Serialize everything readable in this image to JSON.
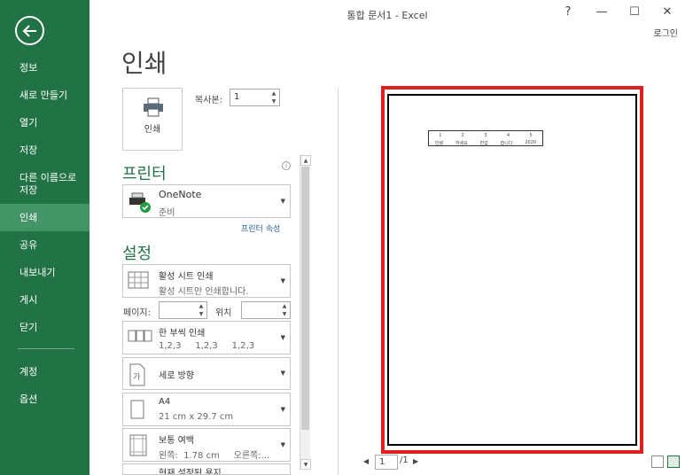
{
  "window": {
    "title": "통합 문서1 - Excel",
    "help": "?",
    "minimize": "—",
    "maximize": "☐",
    "close": "✕",
    "login": "로그인"
  },
  "sidebar": {
    "items": [
      {
        "label": "정보"
      },
      {
        "label": "새로 만들기"
      },
      {
        "label": "열기"
      },
      {
        "label": "저장"
      },
      {
        "label": "다른 이름으로\n저장"
      },
      {
        "label": "인쇄"
      },
      {
        "label": "공유"
      },
      {
        "label": "내보내기"
      },
      {
        "label": "게시"
      },
      {
        "label": "닫기"
      },
      {
        "label": "계정"
      },
      {
        "label": "옵션"
      }
    ],
    "active": "인쇄"
  },
  "main": {
    "title": "인쇄",
    "print_button": "인쇄",
    "copies_label": "복사본:",
    "copies_value": "1",
    "printer_heading": "프린터",
    "printer_name": "OneNote",
    "printer_status": "준비",
    "printer_props": "프린터 속성",
    "settings_heading": "설정",
    "print_what": {
      "title": "활성 시트 인쇄",
      "sub": "활성 시트만 인쇄합니다."
    },
    "pages_label": "페이지:",
    "to_label": "위치",
    "collate": {
      "title": "한 부씩 인쇄",
      "sub": "1,2,3     1,2,3     1,2,3"
    },
    "orientation": {
      "title": "세로 방향"
    },
    "paper": {
      "title": "A4",
      "sub": "21 cm x 29.7 cm"
    },
    "margins": {
      "title": "보통 여백",
      "sub": "왼쪽:  1.78 cm     오른쪽:..."
    },
    "scaling": {
      "title": "현재 설정된 용지"
    }
  },
  "preview": {
    "row1": [
      "1",
      "2",
      "3",
      "4",
      "5"
    ],
    "row2": [
      "안녕",
      "하세요",
      "반갑",
      "습니다",
      "2020"
    ],
    "page_current": "1",
    "page_total": "/1",
    "prev": "◀",
    "next": "▶"
  },
  "colors": {
    "accent": "#217346",
    "highlight": "#e02020"
  }
}
